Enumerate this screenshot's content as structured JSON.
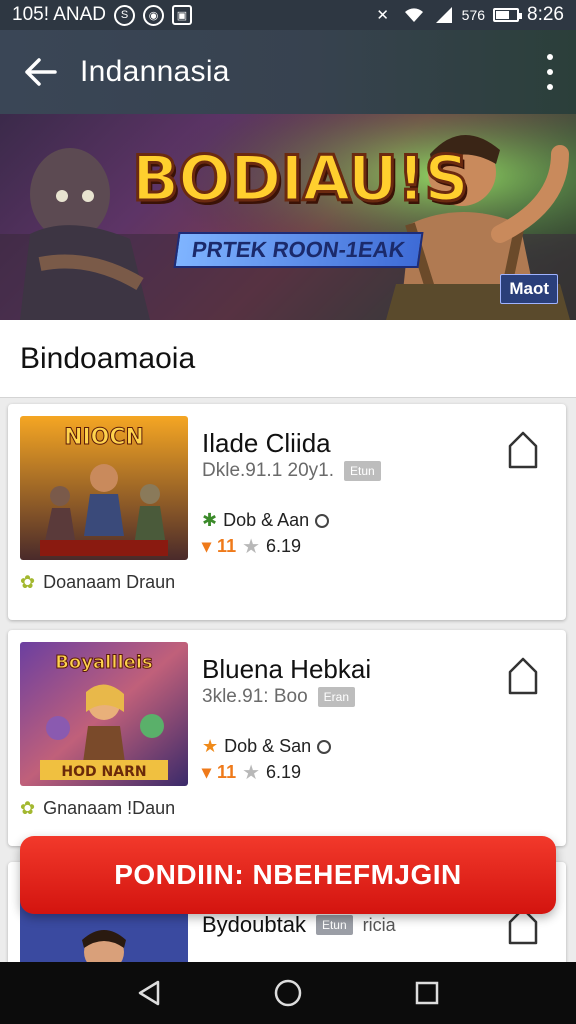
{
  "status_bar": {
    "time_left": "105! ANAD",
    "indicators": "576",
    "time_right": "8:26"
  },
  "app_bar": {
    "title": "Indannasia"
  },
  "banner": {
    "title": "BODIAU!S",
    "subtitle": "PRTEK ROON-1EAK",
    "badge": "Maot"
  },
  "section": {
    "title": "Bindoamaoia"
  },
  "games": [
    {
      "title": "Ilade Cliida",
      "meta": "Dkle.91.1 20y1.",
      "tag": "Etun",
      "genre": "Dob & Aan",
      "fire_count": "11",
      "rating": "6.19",
      "footer": "Doanaam Draun"
    },
    {
      "title": "Bluena Hebkai",
      "meta": "3kle.91: Boo",
      "tag": "Eran",
      "genre": "Dob & San",
      "fire_count": "11",
      "rating": "6.19",
      "footer": "Gnanaam !Daun"
    },
    {
      "title": "Bydoubtak",
      "tag": "Etun",
      "tail": "ricia"
    }
  ],
  "cta": {
    "label": "PONDIIN: NBEHEFMJGIN"
  },
  "colors": {
    "app_bar": "#37424f",
    "cta": "#e0241c",
    "banner_title": "#ffcf2e"
  }
}
